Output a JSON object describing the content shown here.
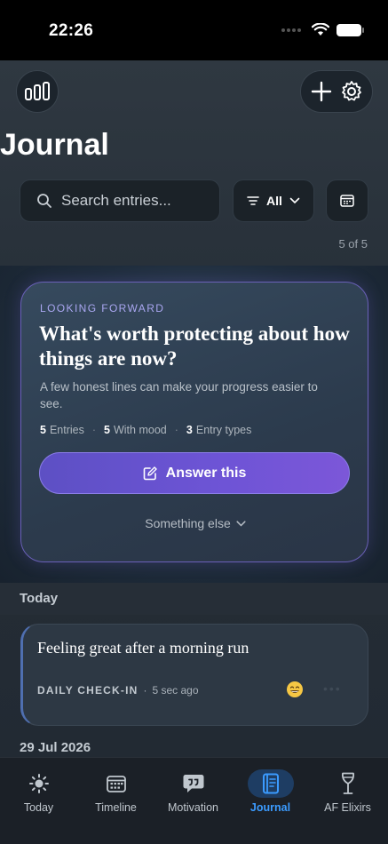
{
  "status": {
    "time": "22:26"
  },
  "header": {
    "title": "Journal"
  },
  "search": {
    "placeholder": "Search entries..."
  },
  "filter": {
    "label": "All"
  },
  "count": "5 of 5",
  "prompt": {
    "eyebrow": "LOOKING FORWARD",
    "question": "What's worth protecting about how things are now?",
    "subtitle": "A few honest lines can make your progress easier to see.",
    "stats": [
      {
        "value": "5",
        "label": "Entries"
      },
      {
        "value": "5",
        "label": "With mood"
      },
      {
        "value": "3",
        "label": "Entry types"
      }
    ],
    "answer_label": "Answer this",
    "other_label": "Something else"
  },
  "sections": {
    "today": "Today",
    "date": "29 Jul 2026"
  },
  "entry": {
    "title": "Feeling great after a morning run",
    "type": "DAILY CHECK-IN",
    "time": "5 sec ago",
    "mood_icon": "grinning-face-emoji"
  },
  "tabs": [
    {
      "label": "Today",
      "icon": "sun-icon"
    },
    {
      "label": "Timeline",
      "icon": "calendar-grid-icon"
    },
    {
      "label": "Motivation",
      "icon": "quote-bubble-icon"
    },
    {
      "label": "Journal",
      "icon": "journal-icon",
      "active": true
    },
    {
      "label": "AF Elixirs",
      "icon": "wine-glass-icon"
    }
  ],
  "colors": {
    "accent": "#3b9bff",
    "button_purple": "#6e54d6",
    "eyebrow": "#a9a6f0"
  }
}
